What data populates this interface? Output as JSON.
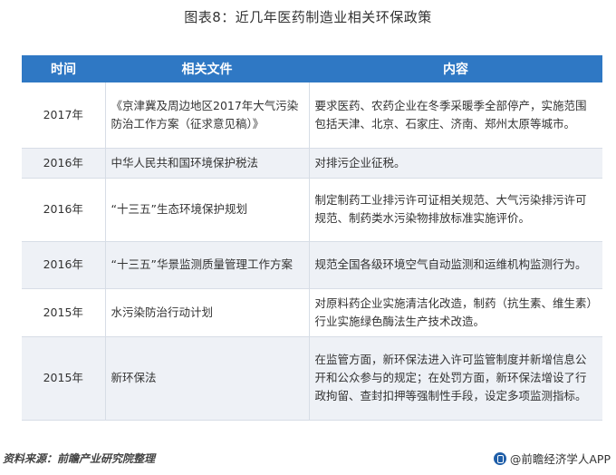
{
  "title": "图表8：近几年医药制造业相关环保政策",
  "table": {
    "headers": [
      "时间",
      "相关文件",
      "内容"
    ],
    "rows": [
      {
        "year": "2017年",
        "document": "《京津冀及周边地区2017年大气污染防治工作方案（征求意见稿）》",
        "content": "要求医药、农药企业在冬季采暖季全部停产，实施范围包括天津、北京、石家庄、济南、郑州太原等城市。"
      },
      {
        "year": "2016年",
        "document": "中华人民共和国环境保护税法",
        "content": "对排污企业征税。"
      },
      {
        "year": "2016年",
        "document": "“十三五”生态环境保护规划",
        "content": "制定制药工业排污许可证相关规范、大气污染排污许可规范、制药类水污染物排放标准实施评价。"
      },
      {
        "year": "2016年",
        "document": "“十三五”华景监测质量管理工作方案",
        "content": "规范全国各级环境空气自动监测和运维机构监测行为。"
      },
      {
        "year": "2015年",
        "document": "水污染防治行动计划",
        "content": "对原料药企业实施清洁化改造，制药（抗生素、维生素）行业实施绿色酶法生产技术改造。"
      },
      {
        "year": "2015年",
        "document": "新环保法",
        "content": "在监管方面，新环保法进入许可监管制度并新增信息公开和公众参与的规定；在处罚方面，新环保法增设了行政拘留、查封扣押等强制性手段，设定多项监测指标。"
      }
    ]
  },
  "source": "资料来源：前瞻产业研究院整理",
  "brand": "@前瞻经济学人APP",
  "colors": {
    "header_bg": "#2f78c4",
    "row_alt": "#eef1f6",
    "border": "#d7dde6"
  }
}
